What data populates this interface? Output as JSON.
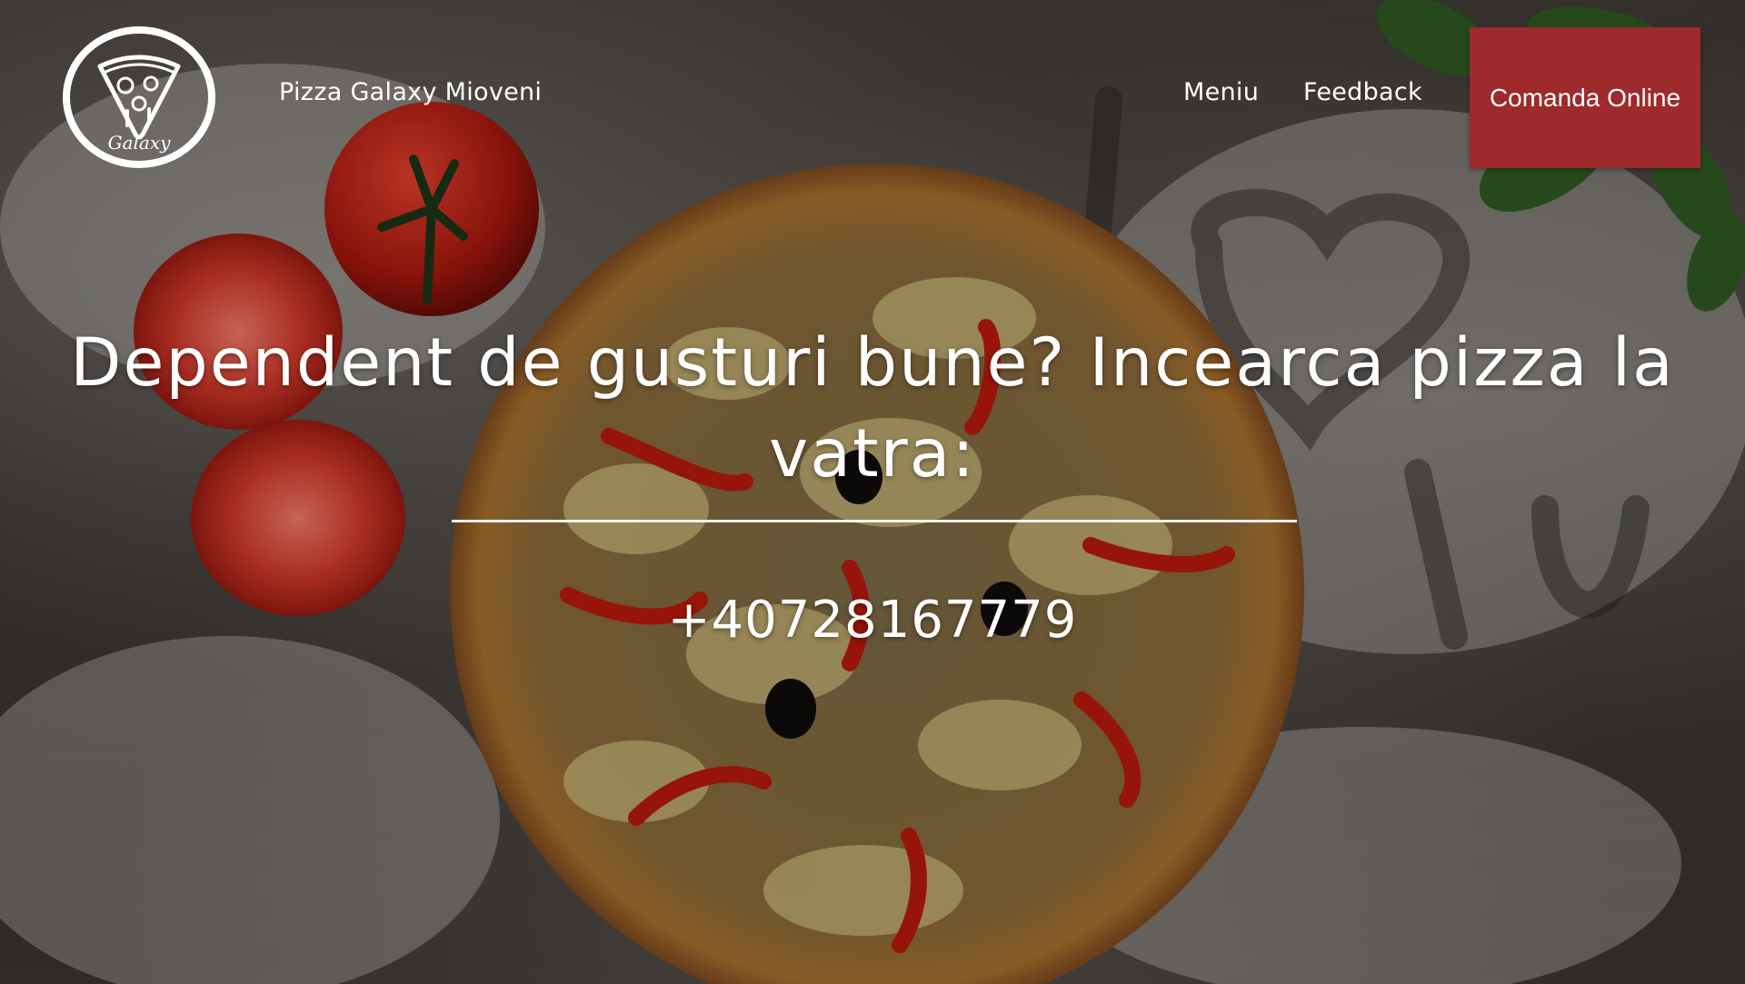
{
  "header": {
    "logo_text": "Galaxy",
    "brand_label": "Pizza Galaxy Mioveni",
    "nav": {
      "menu_label": "Meniu",
      "feedback_label": "Feedback"
    },
    "order_button_label": "Comanda Online"
  },
  "hero": {
    "headline": "Dependent de gusturi bune? Incearca pizza la vatra:",
    "phone": "+40728167779",
    "background_image": "pizza-on-flour-table"
  },
  "colors": {
    "accent": "#9e2a2b",
    "text": "#ffffff"
  },
  "icons": {
    "logo": "pizza-slice-icon"
  }
}
